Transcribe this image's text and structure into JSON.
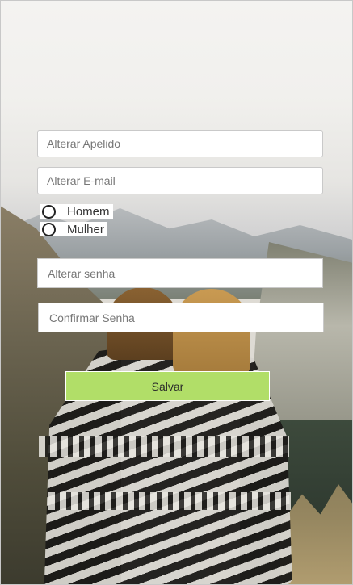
{
  "form": {
    "nickname_placeholder": "Alterar Apelido",
    "email_placeholder": "Alterar E-mail",
    "gender_options": [
      "Homem",
      "Mulher"
    ],
    "password_placeholder": "Alterar senha",
    "confirm_password_placeholder": "Confirmar Senha",
    "save_label": "Salvar"
  },
  "colors": {
    "save_button": "#b1de68",
    "input_background": "#ffffff"
  }
}
